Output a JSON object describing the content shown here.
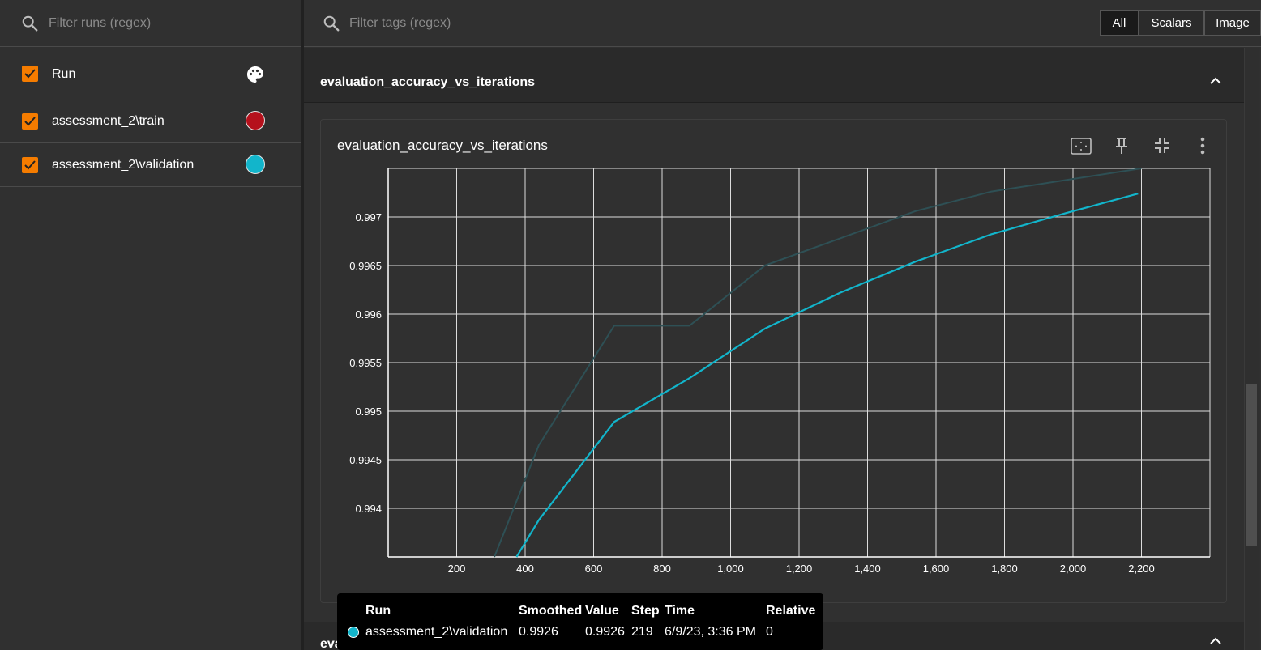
{
  "sidebar": {
    "filter_placeholder": "Filter runs (regex)",
    "header_label": "Run",
    "runs": [
      {
        "label": "assessment_2\\train",
        "color": "#b5111c"
      },
      {
        "label": "assessment_2\\validation",
        "color": "#12b5cb"
      }
    ]
  },
  "topbar": {
    "filter_placeholder": "Filter tags (regex)",
    "toggles": [
      "All",
      "Scalars",
      "Image"
    ],
    "active_toggle": "All"
  },
  "sections": {
    "accuracy_title": "evaluation_accuracy_vs_iterations",
    "loss_title": "evaluation_loss_vs_iterations"
  },
  "card": {
    "title": "evaluation_accuracy_vs_iterations",
    "actions": [
      "fit-domain-icon",
      "pin-icon",
      "collapse-icon",
      "more-vert-icon"
    ]
  },
  "chart_data": {
    "type": "line",
    "title": "evaluation_accuracy_vs_iterations",
    "xlabel": "",
    "ylabel": "",
    "xlim": [
      0,
      2400
    ],
    "ylim": [
      0.9935,
      0.9975
    ],
    "x_ticks": [
      "200",
      "400",
      "600",
      "800",
      "1,000",
      "1,200",
      "1,400",
      "1,600",
      "1,800",
      "2,000",
      "2,200"
    ],
    "y_ticks": [
      "0.994",
      "0.9945",
      "0.995",
      "0.9955",
      "0.996",
      "0.9965",
      "0.997"
    ],
    "grid": true,
    "series": [
      {
        "name": "assessment_2\\validation (raw)",
        "color": "#2e5055",
        "x": [
          310,
          440,
          660,
          880,
          1100,
          1320,
          1540,
          1760,
          1980,
          2200
        ],
        "y": [
          0.9935,
          0.99465,
          0.99588,
          0.99588,
          0.9965,
          0.99678,
          0.99706,
          0.99726,
          0.99738,
          0.9975
        ]
      },
      {
        "name": "assessment_2\\validation (smoothed)",
        "color": "#12b5cb",
        "x": [
          375,
          440,
          660,
          880,
          1100,
          1320,
          1540,
          1760,
          1980,
          2190
        ],
        "y": [
          0.9935,
          0.99388,
          0.99489,
          0.99534,
          0.99585,
          0.99622,
          0.99654,
          0.99682,
          0.99704,
          0.99724
        ]
      }
    ]
  },
  "tooltip": {
    "headers": [
      "Run",
      "Smoothed",
      "Value",
      "Step",
      "Time",
      "Relative"
    ],
    "row": {
      "run": "assessment_2\\validation",
      "smoothed": "0.9926",
      "value": "0.9926",
      "step": "219",
      "time": "6/9/23, 3:36 PM",
      "relative": "0",
      "color": "#12b5cb"
    }
  }
}
